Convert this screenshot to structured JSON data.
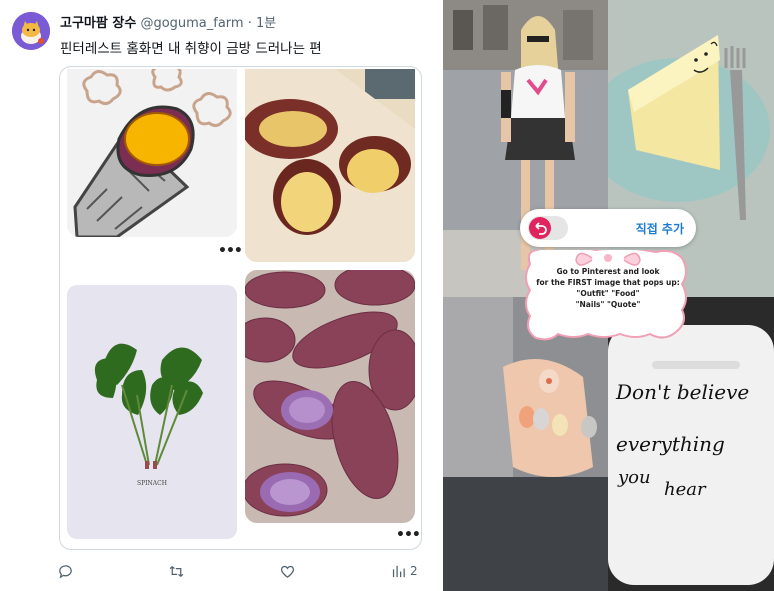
{
  "tweet": {
    "display_name": "고구마팜 장수",
    "handle": "@goguma_farm",
    "separator": "·",
    "time": "1분",
    "text": "핀터레스트 홈화면 내 취향이 금방 드러나는 편",
    "more_label": "•••",
    "stats": {
      "views": "2"
    }
  },
  "pins": [
    {
      "name": "roasted-sweet-potato-illustration"
    },
    {
      "name": "baked-sweet-potatoes-photo"
    },
    {
      "name": "spinach-photo",
      "caption": "SPINACH"
    },
    {
      "name": "purple-sweet-potatoes-photo"
    }
  ],
  "collage": {
    "add_button_label": "직접 추가",
    "note_lines": [
      "Go to Pinterest and look",
      "for the FIRST image that pops up:",
      "\"Outfit\"   \"Food\"",
      "\"Nails\"   \"Quote\""
    ],
    "quote_lines": [
      "Don't believe",
      "everything",
      "you",
      "hear"
    ]
  },
  "colors": {
    "accent": "#1d9bf0",
    "toggle": "#e0245e",
    "border": "#cfd9de",
    "muted": "#536471"
  }
}
